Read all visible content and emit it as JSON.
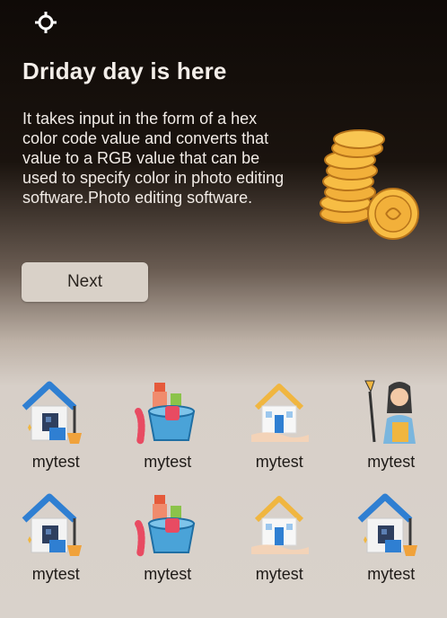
{
  "hero": {
    "title": "Driday day is here",
    "description": "It takes input in the form of a hex color code value and converts that value to a RGB value that can be used to specify color in photo editing software.Photo editing software.",
    "next_label": "Next",
    "settings_icon": "target-icon",
    "illustration": "gold-coins-icon"
  },
  "grid": {
    "items": [
      {
        "label": "mytest",
        "icon": "house-cleaning-icon"
      },
      {
        "label": "mytest",
        "icon": "cleaning-bucket-icon"
      },
      {
        "label": "mytest",
        "icon": "house-hand-icon"
      },
      {
        "label": "mytest",
        "icon": "cleaner-person-icon"
      },
      {
        "label": "mytest",
        "icon": "house-cleaning-icon"
      },
      {
        "label": "mytest",
        "icon": "cleaning-bucket-icon"
      },
      {
        "label": "mytest",
        "icon": "house-hand-icon"
      },
      {
        "label": "mytest",
        "icon": "house-cleaning-icon"
      }
    ]
  }
}
